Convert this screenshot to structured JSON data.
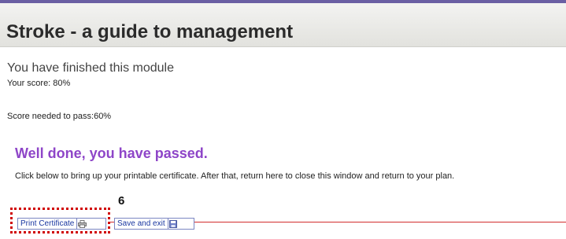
{
  "header": {
    "title": "Stroke - a guide to management"
  },
  "result": {
    "heading": "You have finished this module",
    "score": "Your score: 80%",
    "score_needed": "Score needed to pass:60%",
    "status": "Well done, you have passed.",
    "instructions": "Click below to bring up your printable certificate. After that, return here to close this window and return to your plan."
  },
  "annotation": {
    "step": "6"
  },
  "actions": {
    "print_label": "Print Certificate",
    "save_label": "Save and exit"
  },
  "colors": {
    "accent_purple": "#8e45c8",
    "highlight_red": "#d00000",
    "link_blue": "#1a37a0"
  },
  "icons": {
    "print": "printer-icon",
    "save": "save-disk-icon"
  }
}
